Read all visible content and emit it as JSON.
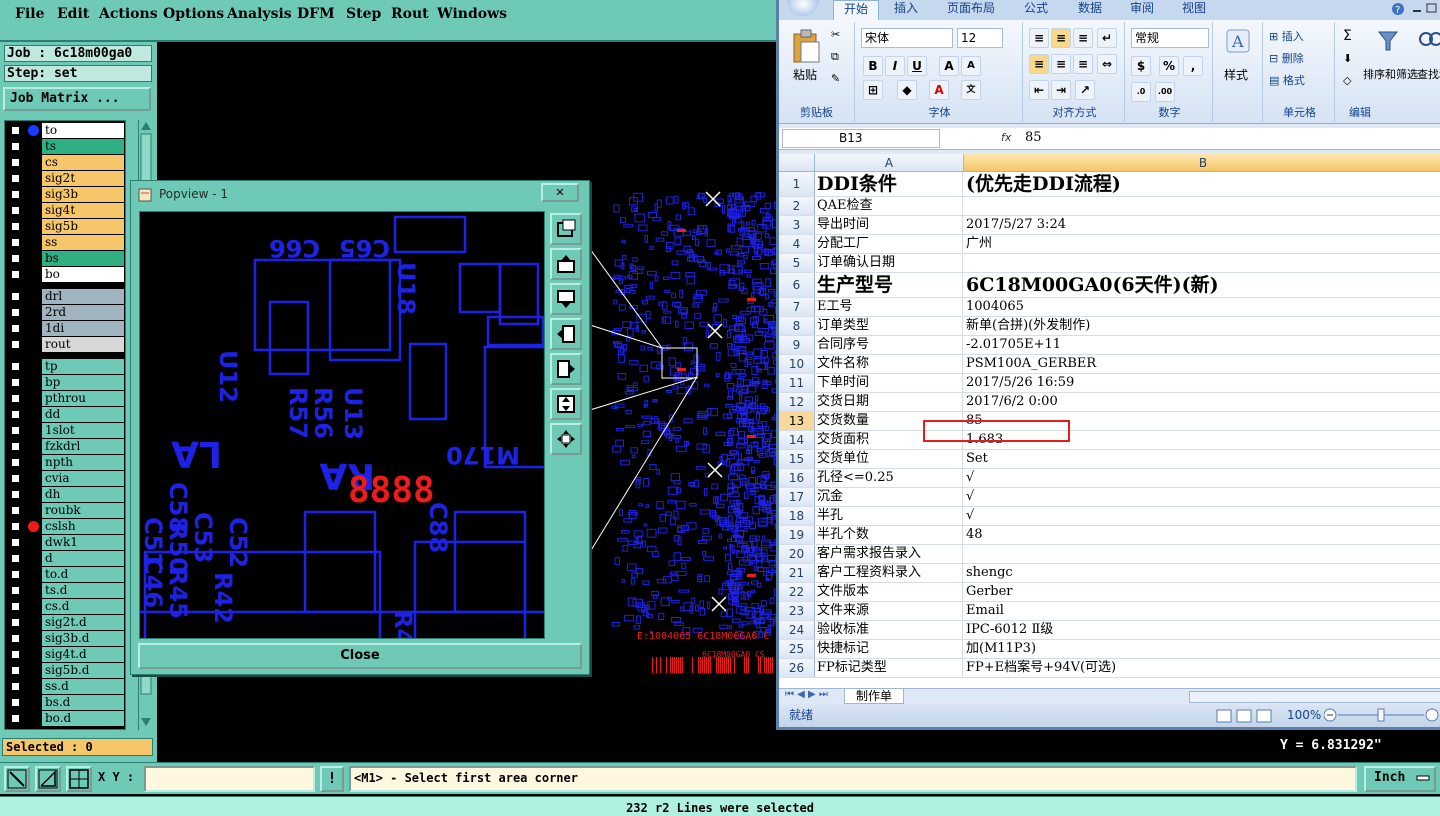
{
  "menu": [
    "File",
    "Edit",
    "Actions",
    "Options",
    "Analysis",
    "DFM",
    "Step",
    "Rout",
    "Windows"
  ],
  "job": {
    "label": "Job : 6c18m00ga0",
    "step": "Step: set",
    "matrix_button": "Job Matrix ..."
  },
  "layers": [
    {
      "name": "to",
      "color": "#ffffff",
      "dot": "#1a3cff"
    },
    {
      "name": "ts",
      "color": "#2fb082",
      "dot": ""
    },
    {
      "name": "cs",
      "color": "#f5c66a",
      "dot": ""
    },
    {
      "name": "sig2t",
      "color": "#f5c66a",
      "dot": ""
    },
    {
      "name": "sig3b",
      "color": "#f5c66a",
      "dot": ""
    },
    {
      "name": "sig4t",
      "color": "#f5c66a",
      "dot": ""
    },
    {
      "name": "sig5b",
      "color": "#f5c66a",
      "dot": ""
    },
    {
      "name": "ss",
      "color": "#f5c66a",
      "dot": ""
    },
    {
      "name": "bs",
      "color": "#2fb082",
      "dot": ""
    },
    {
      "name": "bo",
      "color": "#ffffff",
      "dot": ""
    },
    {
      "name": "drl",
      "color": "#9fb4bf",
      "dot": ""
    },
    {
      "name": "2rd",
      "color": "#9fb4bf",
      "dot": ""
    },
    {
      "name": "1di",
      "color": "#9fb4bf",
      "dot": ""
    },
    {
      "name": "rout",
      "color": "#d7d7d7",
      "dot": ""
    },
    {
      "name": "tp",
      "color": "#6ec9b7",
      "dot": ""
    },
    {
      "name": "bp",
      "color": "#6ec9b7",
      "dot": ""
    },
    {
      "name": "pthrou",
      "color": "#6ec9b7",
      "dot": ""
    },
    {
      "name": "dd",
      "color": "#6ec9b7",
      "dot": ""
    },
    {
      "name": "1slot",
      "color": "#6ec9b7",
      "dot": ""
    },
    {
      "name": "fzkdrl",
      "color": "#6ec9b7",
      "dot": ""
    },
    {
      "name": "npth",
      "color": "#6ec9b7",
      "dot": ""
    },
    {
      "name": "cvia",
      "color": "#6ec9b7",
      "dot": ""
    },
    {
      "name": "dh",
      "color": "#6ec9b7",
      "dot": ""
    },
    {
      "name": "roubk",
      "color": "#6ec9b7",
      "dot": ""
    },
    {
      "name": "cslsh",
      "color": "#6ec9b7",
      "dot": "#ee1b1b"
    },
    {
      "name": "dwk1",
      "color": "#6ec9b7",
      "dot": ""
    },
    {
      "name": "d",
      "color": "#6ec9b7",
      "dot": ""
    },
    {
      "name": "to.d",
      "color": "#6ec9b7",
      "dot": ""
    },
    {
      "name": "ts.d",
      "color": "#6ec9b7",
      "dot": ""
    },
    {
      "name": "cs.d",
      "color": "#6ec9b7",
      "dot": ""
    },
    {
      "name": "sig2t.d",
      "color": "#6ec9b7",
      "dot": ""
    },
    {
      "name": "sig3b.d",
      "color": "#6ec9b7",
      "dot": ""
    },
    {
      "name": "sig4t.d",
      "color": "#6ec9b7",
      "dot": ""
    },
    {
      "name": "sig5b.d",
      "color": "#6ec9b7",
      "dot": ""
    },
    {
      "name": "ss.d",
      "color": "#6ec9b7",
      "dot": ""
    },
    {
      "name": "bs.d",
      "color": "#6ec9b7",
      "dot": ""
    },
    {
      "name": "bo.d",
      "color": "#6ec9b7",
      "dot": ""
    }
  ],
  "selected_label": "Selected : 0",
  "popview": {
    "title": "Popview - 1",
    "close_x": "✕",
    "close_button": "Close"
  },
  "canvas_text": {
    "red_digits": "8888",
    "silk1": "C66",
    "silk2": "C65",
    "silk3": "M170",
    "silk4": "C88",
    "silk5": "RA",
    "silk6": "LA",
    "silk7": "R57",
    "silk8": "R56",
    "silk9": "U13",
    "silk10": "U12",
    "silk11": "C58",
    "silk12": "R50",
    "silk13": "C53",
    "silk14": "C52",
    "silk15": "C51",
    "silk16": "R45",
    "silk17": "C46",
    "silk18": "R42",
    "silk19": "U18",
    "silk20": "R4",
    "board_text1": "E:1004065 6C18M00GA0 C",
    "board_text2": "6C18M00GA0 CS"
  },
  "cmd": {
    "xy_label": "X Y :",
    "prompt": "<M1> - Select first area corner",
    "unit": "Inch",
    "y_coord": "Y = 6.831292\""
  },
  "status": "232 r2 Lines were selected",
  "excel": {
    "tabs": [
      "开始",
      "插入",
      "页面布局",
      "公式",
      "数据",
      "审阅",
      "视图"
    ],
    "font_name": "宋体",
    "font_size": "12",
    "number_format": "常规",
    "groups": [
      "剪贴板",
      "字体",
      "对齐方式",
      "数字",
      "单元格",
      "编辑"
    ],
    "paste_label": "粘贴",
    "styles_label": "样式",
    "insert_label": "插入",
    "delete_label": "删除",
    "format_label": "格式",
    "sort_label": "排序和筛选",
    "find_label": "查找和选择",
    "name_box": "B13",
    "fx": "fx",
    "formula_value": "85",
    "col_a": "A",
    "col_b": "B",
    "rows": [
      {
        "n": "1",
        "a": "DDI条件",
        "b": "(优先走DDI流程)",
        "big": true
      },
      {
        "n": "2",
        "a": "QAE检查",
        "b": ""
      },
      {
        "n": "3",
        "a": "导出时间",
        "b": "2017/5/27 3:24"
      },
      {
        "n": "4",
        "a": "分配工厂",
        "b": "广州"
      },
      {
        "n": "5",
        "a": "订单确认日期",
        "b": ""
      },
      {
        "n": "6",
        "a": "生产型号",
        "b": "6C18M00GA0(6天件)(新)",
        "big": true
      },
      {
        "n": "7",
        "a": "E工号",
        "b": "1004065"
      },
      {
        "n": "8",
        "a": "订单类型",
        "b": "新单(合拼)(外发制作)"
      },
      {
        "n": "9",
        "a": "合同序号",
        "b": "-2.01705E+11"
      },
      {
        "n": "10",
        "a": "文件名称",
        "b": "PSM100A_GERBER"
      },
      {
        "n": "11",
        "a": "下单时间",
        "b": "2017/5/26 16:59"
      },
      {
        "n": "12",
        "a": "交货日期",
        "b": "2017/6/2 0:00"
      },
      {
        "n": "13",
        "a": "交货数量",
        "b": "85",
        "sel": true
      },
      {
        "n": "14",
        "a": "交货面积",
        "b": "1.683"
      },
      {
        "n": "15",
        "a": "交货单位",
        "b": "Set"
      },
      {
        "n": "16",
        "a": "孔径<=0.25",
        "b": "√"
      },
      {
        "n": "17",
        "a": "沉金",
        "b": "√"
      },
      {
        "n": "18",
        "a": "半孔",
        "b": "√"
      },
      {
        "n": "19",
        "a": "半孔个数",
        "b": "48"
      },
      {
        "n": "20",
        "a": "客户需求报告录入",
        "b": ""
      },
      {
        "n": "21",
        "a": "客户工程资料录入",
        "b": "shengc"
      },
      {
        "n": "22",
        "a": "文件版本",
        "b": "Gerber"
      },
      {
        "n": "23",
        "a": "文件来源",
        "b": "Email"
      },
      {
        "n": "24",
        "a": "验收标准",
        "b": "IPC-6012 Ⅱ级"
      },
      {
        "n": "25",
        "a": "快捷标记",
        "b": "加(M11P3)"
      },
      {
        "n": "26",
        "a": "FP标记类型",
        "b": "FP+E档案号+94V(可选)"
      }
    ],
    "sheet": "制作单",
    "ready": "就绪",
    "zoom": "100%"
  }
}
